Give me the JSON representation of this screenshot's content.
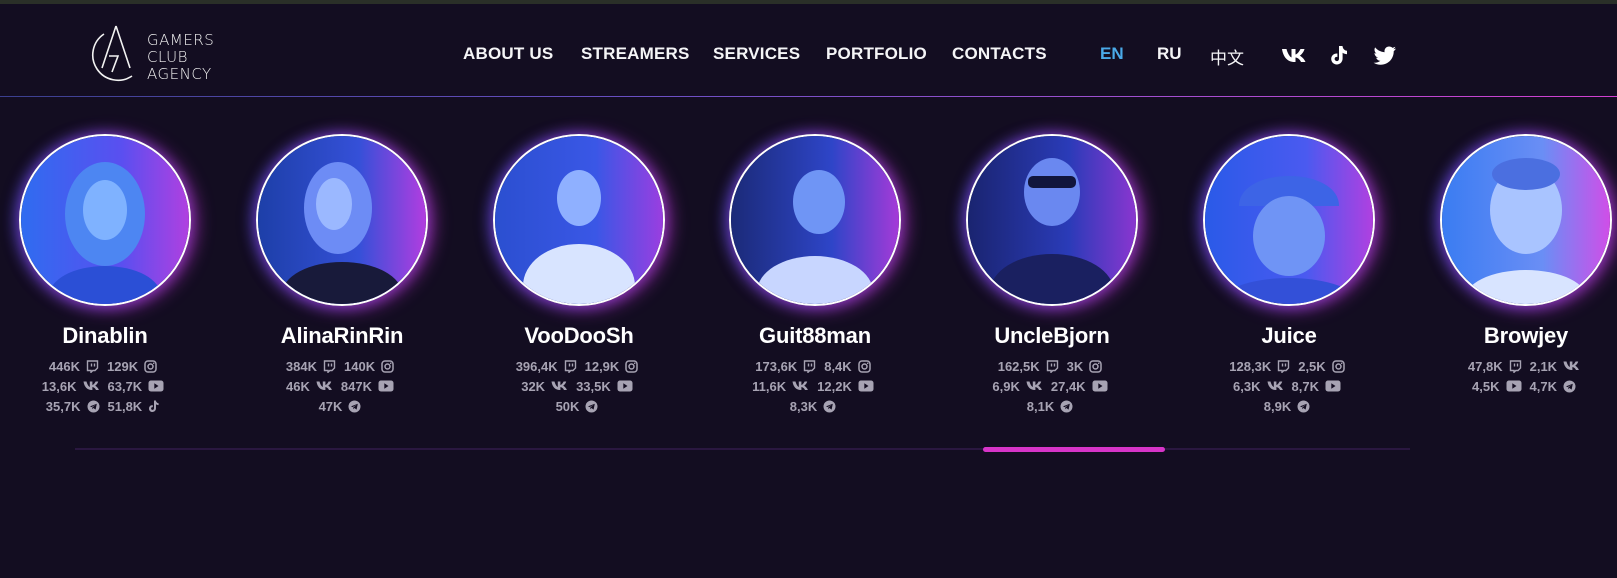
{
  "brand": {
    "line1": "GAMERS",
    "line2": "CLUB",
    "line3": "AGENCY"
  },
  "nav": {
    "about": "ABOUT US",
    "streamers": "STREAMERS",
    "services": "SERVICES",
    "portfolio": "PORTFOLIO",
    "contacts": "CONTACTS"
  },
  "languages": {
    "en": "EN",
    "ru": "RU",
    "zh": "中文",
    "active": "EN"
  },
  "social": [
    "vk-icon",
    "tiktok-icon",
    "twitter-icon"
  ],
  "colors": {
    "background": "#130d21",
    "accent_blue": "#4aa9e8",
    "accent_pink": "#d734c8",
    "stat_text": "#a7a3b3"
  },
  "streamers": [
    {
      "name": "Dinablin",
      "stats": [
        [
          "446K",
          "twitch"
        ],
        [
          "129K",
          "instagram"
        ],
        [
          "13,6K",
          "vk"
        ],
        [
          "63,7K",
          "youtube"
        ],
        [
          "35,7K",
          "telegram"
        ],
        [
          "51,8K",
          "tiktok"
        ]
      ]
    },
    {
      "name": "AlinaRinRin",
      "stats": [
        [
          "384K",
          "twitch"
        ],
        [
          "140K",
          "instagram"
        ],
        [
          "46K",
          "vk"
        ],
        [
          "847K",
          "youtube"
        ],
        [
          "47K",
          "telegram"
        ]
      ]
    },
    {
      "name": "VooDooSh",
      "stats": [
        [
          "396,4K",
          "twitch"
        ],
        [
          "12,9K",
          "instagram"
        ],
        [
          "32K",
          "vk"
        ],
        [
          "33,5K",
          "youtube"
        ],
        [
          "50K",
          "telegram"
        ]
      ]
    },
    {
      "name": "Guit88man",
      "stats": [
        [
          "173,6K",
          "twitch"
        ],
        [
          "8,4K",
          "instagram"
        ],
        [
          "11,6K",
          "vk"
        ],
        [
          "12,2K",
          "youtube"
        ],
        [
          "8,3K",
          "telegram"
        ]
      ]
    },
    {
      "name": "UncleBjorn",
      "stats": [
        [
          "162,5K",
          "twitch"
        ],
        [
          "3K",
          "instagram"
        ],
        [
          "6,9K",
          "vk"
        ],
        [
          "27,4K",
          "youtube"
        ],
        [
          "8,1K",
          "telegram"
        ]
      ]
    },
    {
      "name": "Juice",
      "stats": [
        [
          "128,3K",
          "twitch"
        ],
        [
          "2,5K",
          "instagram"
        ],
        [
          "6,3K",
          "vk"
        ],
        [
          "8,7K",
          "youtube"
        ],
        [
          "8,9K",
          "telegram"
        ]
      ]
    },
    {
      "name": "Browjey",
      "stats": [
        [
          "47,8K",
          "twitch"
        ],
        [
          "2,1K",
          "vk"
        ],
        [
          "4,5K",
          "youtube"
        ],
        [
          "4,7K",
          "telegram"
        ]
      ]
    }
  ],
  "carousel": {
    "position_fraction": 0.68,
    "visible_fraction": 0.136
  }
}
